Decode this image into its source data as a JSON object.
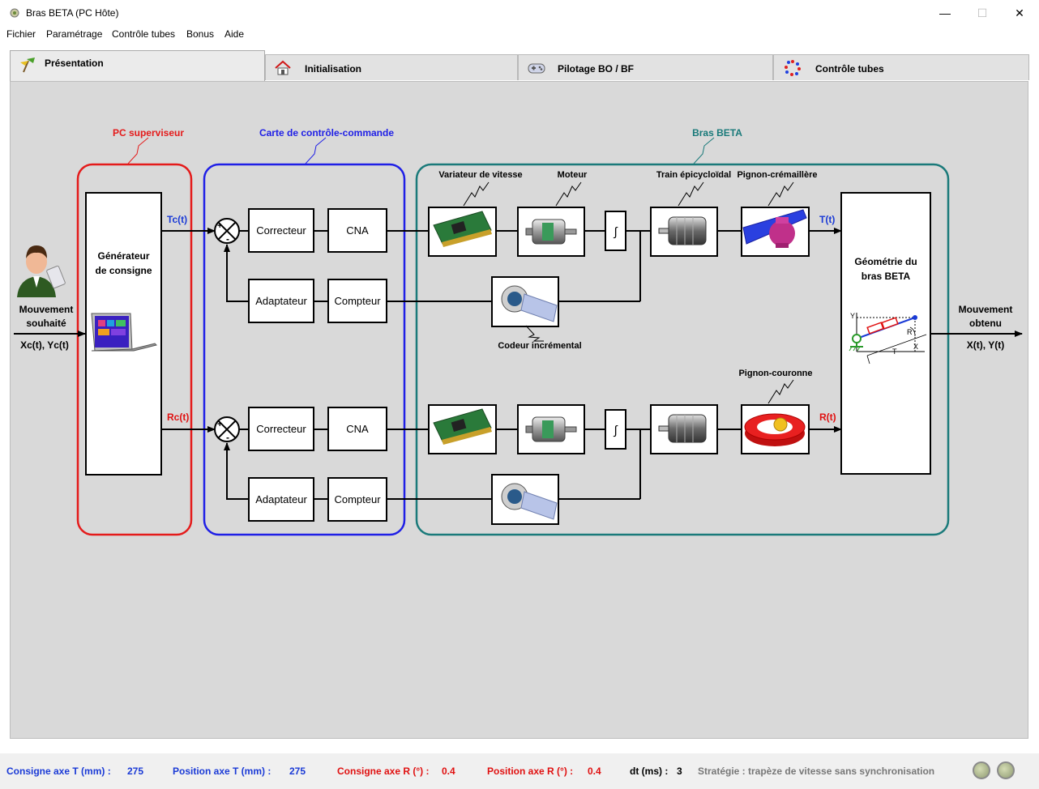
{
  "window": {
    "title": "Bras BETA (PC Hôte)",
    "minimize": "—",
    "maximize": "☐",
    "close": "✕"
  },
  "menu": [
    "Fichier",
    "Paramétrage",
    "Contrôle tubes",
    "Bonus",
    "Aide"
  ],
  "tabs": [
    "Présentation",
    "Initialisation",
    "Pilotage BO / BF",
    "Contrôle tubes"
  ],
  "diagram": {
    "groups": {
      "pc": "PC superviseur",
      "carte": "Carte de contrôle-commande",
      "bras": "Bras BETA"
    },
    "input": {
      "label1": "Mouvement",
      "label2": "souhaité",
      "signal": "Xc(t), Yc(t)"
    },
    "output": {
      "label1": "Mouvement",
      "label2": "obtenu",
      "signal": "X(t), Y(t)"
    },
    "generator": {
      "line1": "Générateur",
      "line2": "de consigne"
    },
    "signals": {
      "tc": "Tc(t)",
      "rc": "Rc(t)",
      "t": "T(t)",
      "r": "R(t)"
    },
    "blocks": {
      "correcteur": "Correcteur",
      "cna": "CNA",
      "adaptateur": "Adaptateur",
      "compteur": "Compteur",
      "integ": "∫"
    },
    "components": {
      "variateur": "Variateur de vitesse",
      "moteur": "Moteur",
      "train": "Train épicycloïdal",
      "pignon_cremaillere": "Pignon-crémaillère",
      "codeur": "Codeur incrémental",
      "pignon_couronne": "Pignon-couronne"
    },
    "geometry": {
      "line1": "Géométrie du",
      "line2": "bras BETA",
      "axis_y": "Y",
      "axis_x": "X",
      "label_r": "R",
      "label_t": "T"
    },
    "sum_plus": "+",
    "sum_minus": "-"
  },
  "status": {
    "consigne_t_label": "Consigne axe T (mm) :",
    "consigne_t_value": "275",
    "position_t_label": "Position axe T (mm) :",
    "position_t_value": "275",
    "consigne_r_label": "Consigne axe R (°) :",
    "consigne_r_value": "0.4",
    "position_r_label": "Position axe R (°) :",
    "position_r_value": "0.4",
    "dt_label": "dt (ms) :",
    "dt_value": "3",
    "strategie": "Stratégie : trapèze de vitesse sans synchronisation"
  },
  "colors": {
    "t_axis": "#1a3ad6",
    "r_axis": "#e01010",
    "pc": "#e41b1b",
    "carte": "#1f1fe6",
    "bras": "#1a7a7a",
    "strategie": "#777777"
  }
}
